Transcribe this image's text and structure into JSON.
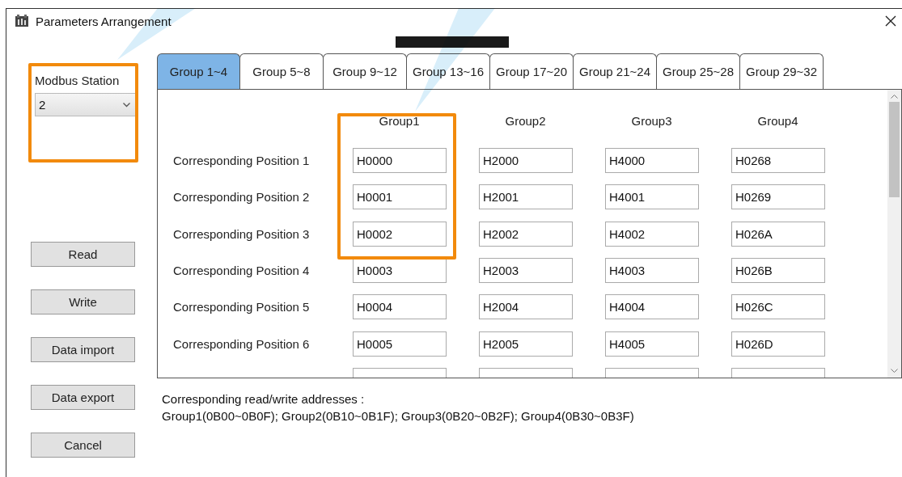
{
  "window": {
    "title": "Parameters Arrangement"
  },
  "station": {
    "label": "Modbus Station",
    "value": "2"
  },
  "buttons": [
    "Read",
    "Write",
    "Data import",
    "Data export",
    "Cancel"
  ],
  "tabs": [
    {
      "label": "Group 1~4",
      "selected": true
    },
    {
      "label": "Group 5~8",
      "selected": false
    },
    {
      "label": "Group 9~12",
      "selected": false
    },
    {
      "label": "Group 13~16",
      "selected": false
    },
    {
      "label": "Group 17~20",
      "selected": false
    },
    {
      "label": "Group 21~24",
      "selected": false
    },
    {
      "label": "Group 25~28",
      "selected": false
    },
    {
      "label": "Group 29~32",
      "selected": false
    }
  ],
  "table": {
    "columns": [
      "Group1",
      "Group2",
      "Group3",
      "Group4"
    ],
    "rows": [
      {
        "label": "Corresponding Position 1",
        "values": [
          "H0000",
          "H2000",
          "H4000",
          "H0268"
        ]
      },
      {
        "label": "Corresponding Position 2",
        "values": [
          "H0001",
          "H2001",
          "H4001",
          "H0269"
        ]
      },
      {
        "label": "Corresponding Position 3",
        "values": [
          "H0002",
          "H2002",
          "H4002",
          "H026A"
        ]
      },
      {
        "label": "Corresponding Position 4",
        "values": [
          "H0003",
          "H2003",
          "H4003",
          "H026B"
        ]
      },
      {
        "label": "Corresponding Position 5",
        "values": [
          "H0004",
          "H2004",
          "H4004",
          "H026C"
        ]
      },
      {
        "label": "Corresponding Position 6",
        "values": [
          "H0005",
          "H2005",
          "H4005",
          "H026D"
        ]
      }
    ]
  },
  "note": [
    "Corresponding read/write addresses :",
    "Group1(0B00~0B0F); Group2(0B10~0B1F); Group3(0B20~0B2F); Group4(0B30~0B3F)"
  ]
}
